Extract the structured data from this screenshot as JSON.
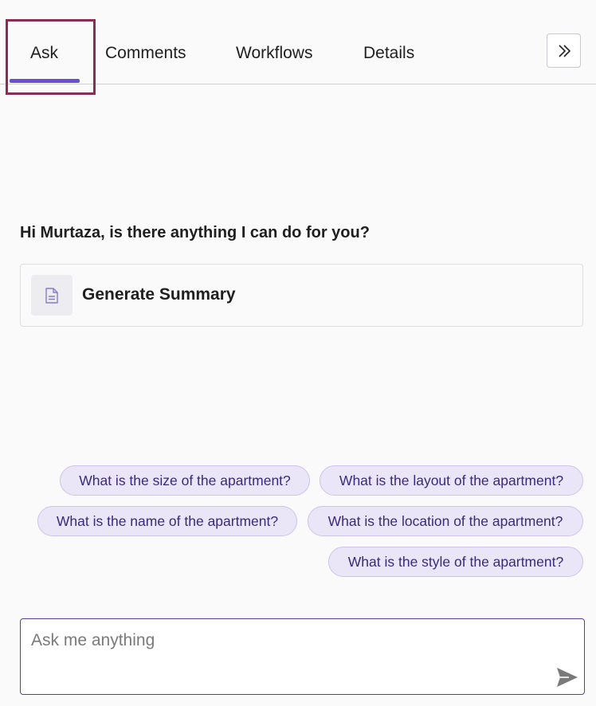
{
  "tabs": [
    {
      "label": "Ask",
      "active": true
    },
    {
      "label": "Comments"
    },
    {
      "label": "Workflows"
    },
    {
      "label": "Details"
    }
  ],
  "colors": {
    "accent": "#6c4fd6",
    "highlight_border": "#8a2d55",
    "chip_bg": "#ebe6f7",
    "chip_text": "#3a2a7a"
  },
  "icons": {
    "collapse": "chevrons-right-icon",
    "summary": "document-icon",
    "send": "send-icon"
  },
  "greeting": "Hi Murtaza, is there anything I can do for you?",
  "summary_card": {
    "label": "Generate Summary"
  },
  "suggestions": [
    "What is the size of the apartment?",
    "What is the layout of the apartment?",
    "What is the name of the apartment?",
    "What is the location of the apartment?",
    "What is the style of the apartment?"
  ],
  "ask_input": {
    "placeholder": "Ask me anything",
    "value": ""
  }
}
